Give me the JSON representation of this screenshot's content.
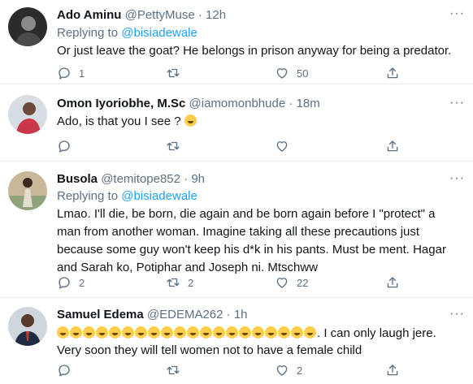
{
  "tweets": [
    {
      "name": "Ado Aminu",
      "handle": "@PettyMuse",
      "time": "12h",
      "replying_prefix": "Replying to ",
      "replying_to": "@bisiadewale",
      "text": "Or just leave the goat? He belongs in prison anyway for being a predator.",
      "replies": "1",
      "retweets": "",
      "likes": "50"
    },
    {
      "name": "Omon Iyoriobhe, M.Sc",
      "handle": "@iamomonbhude",
      "time": "18m",
      "text": "Ado, is that you I see ?",
      "emoji": "upside-down-face",
      "replies": "",
      "retweets": "",
      "likes": ""
    },
    {
      "name": "Busola",
      "handle": "@temitope852",
      "time": "9h",
      "replying_prefix": "Replying to ",
      "replying_to": "@bisiadewale",
      "text": "Lmao. I'll die, be born, die again and be born again before I \"protect\" a man from another woman. Imagine taking all these precautions just because some guy won't keep his d*k in his pants. Must be ment. Hagar and Sarah ko, Potiphar and Joseph ni. Mtschww",
      "replies": "2",
      "retweets": "2",
      "likes": "22"
    },
    {
      "name": "Samuel Edema",
      "handle": "@EDEMA262",
      "time": "1h",
      "emoji": "rolling-on-floor-laughing",
      "emoji_count": 20,
      "text": ". I can only laugh jere. Very soon they will tell women not to have a female child",
      "replies": "",
      "retweets": "",
      "likes": "2"
    }
  ],
  "separator": "·",
  "icons": [
    "reply-icon",
    "retweet-icon",
    "like-icon",
    "share-icon",
    "more-icon"
  ],
  "colors": {
    "link": "#1da1f2",
    "muted": "#5b7083",
    "text": "#0f1419",
    "border": "#e6ecf0"
  }
}
